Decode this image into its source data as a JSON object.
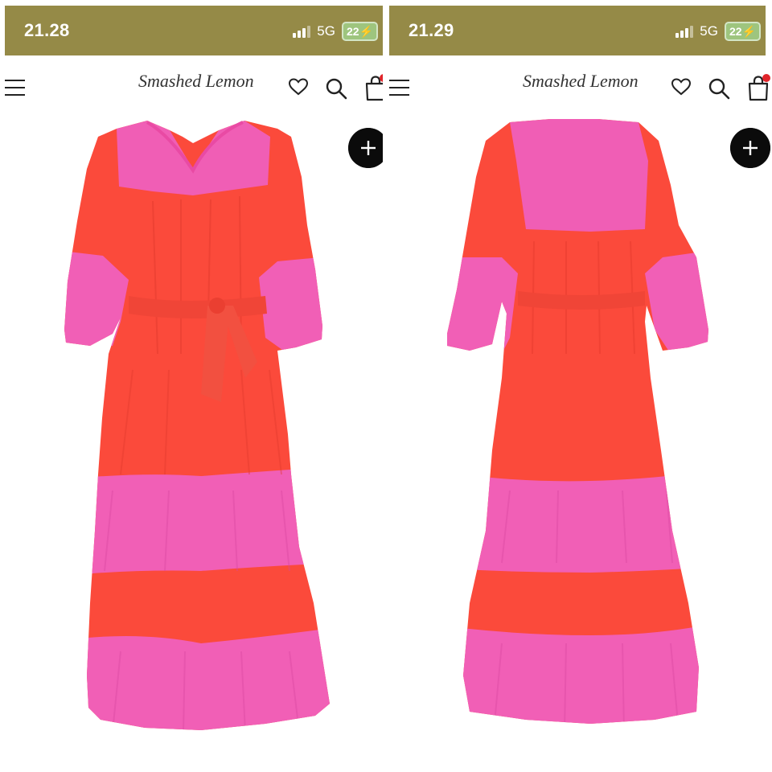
{
  "screens": [
    {
      "status": {
        "time": "21.28",
        "network": "5G",
        "battery": "22"
      },
      "header": {
        "brand": "Smashed Lemon"
      }
    },
    {
      "status": {
        "time": "21.29",
        "network": "5G",
        "battery": "22"
      },
      "header": {
        "brand": "Smashed Lemon"
      }
    }
  ],
  "colors": {
    "statusbar": "#958a47",
    "dress_orange": "#fb4a3b",
    "dress_pink": "#f15fb6",
    "plus_button": "#0b0b0b",
    "cart_badge": "#e0242a"
  },
  "icons": [
    "menu-icon",
    "heart-icon",
    "search-icon",
    "shopping-bag-icon",
    "plus-icon",
    "signal-icon",
    "battery-icon"
  ]
}
